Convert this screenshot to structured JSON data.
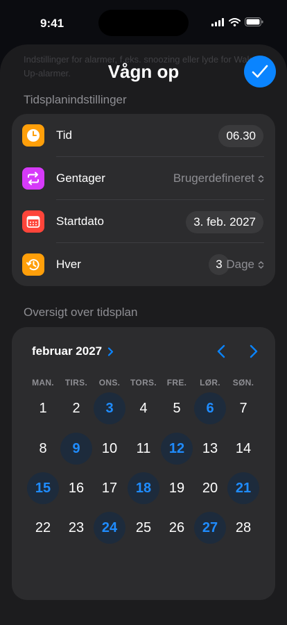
{
  "status_bar": {
    "time": "9:41"
  },
  "sheet": {
    "background_hint": "Indstillinger for alarmer, f.eks. snoozing eller lyde for Wake Up-alarmer.",
    "title": "Vågn op",
    "confirm_icon": "checkmark-icon"
  },
  "schedule_settings": {
    "section_title": "Tidsplanindstillinger",
    "time": {
      "label": "Tid",
      "value": "06.30",
      "icon": "clock-icon"
    },
    "repeat": {
      "label": "Gentager",
      "value": "Brugerdefineret",
      "icon": "repeat-icon"
    },
    "start_date": {
      "label": "Startdato",
      "value": "3. feb. 2027",
      "icon": "calendar-icon"
    },
    "every": {
      "label": "Hver",
      "count": "3",
      "unit": "Dage",
      "icon": "history-icon"
    }
  },
  "overview": {
    "section_title": "Oversigt over tidsplan",
    "month": "februar 2027",
    "weekdays": [
      "MAN.",
      "TIRS.",
      "ONS.",
      "TORS.",
      "FRE.",
      "LØR.",
      "SØN."
    ],
    "weeks": [
      [
        "1",
        "2",
        "3",
        "4",
        "5",
        "6",
        "7"
      ],
      [
        "8",
        "9",
        "10",
        "11",
        "12",
        "13",
        "14"
      ],
      [
        "15",
        "16",
        "17",
        "18",
        "19",
        "20",
        "21"
      ],
      [
        "22",
        "23",
        "24",
        "25",
        "26",
        "27",
        "28"
      ]
    ],
    "selected_days": [
      "3",
      "6",
      "9",
      "12",
      "15",
      "18",
      "21",
      "24",
      "27"
    ]
  },
  "colors": {
    "accent": "#0a84ff",
    "time_icon": "#ff9f0a",
    "repeat_icon": "#d63af9",
    "start_icon": "#ff453a",
    "every_icon": "#ff9f0a"
  }
}
